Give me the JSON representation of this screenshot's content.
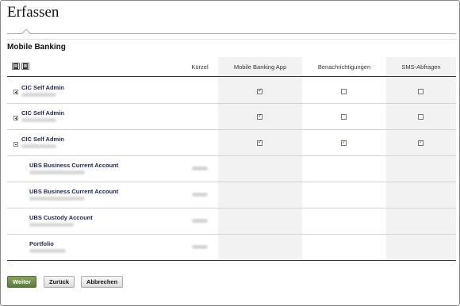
{
  "page": {
    "title": "Erfassen",
    "section_title": "Mobile Banking"
  },
  "table": {
    "columns": {
      "kuerzel": "Kürzel",
      "app": "Mobile Banking App",
      "notify": "Benachrichtigungen",
      "sms": "SMS-Abfragen"
    },
    "header_icons": [
      "expand-all-icon",
      "collapse-all-icon"
    ],
    "rows": [
      {
        "name": "CIC Self Admin",
        "expander": "plus",
        "app": true,
        "notify": false,
        "sms": false
      },
      {
        "name": "CIC Self Admin",
        "expander": "plus",
        "app": true,
        "notify": false,
        "sms": false
      },
      {
        "name": "CIC Self Admin",
        "expander": "minus",
        "app": true,
        "notify": true,
        "sms": true
      }
    ],
    "accounts": [
      {
        "name": "UBS Business Current Account"
      },
      {
        "name": "UBS Business Current Account"
      },
      {
        "name": "UBS Custody Account"
      },
      {
        "name": "Portfolio"
      }
    ]
  },
  "buttons": {
    "next": "Weiter",
    "back": "Zurück",
    "cancel": "Abbrechen"
  },
  "colors": {
    "primary_button": "#6b8a46",
    "check_green": "#3a8a2a",
    "name_text": "#1c2450"
  }
}
